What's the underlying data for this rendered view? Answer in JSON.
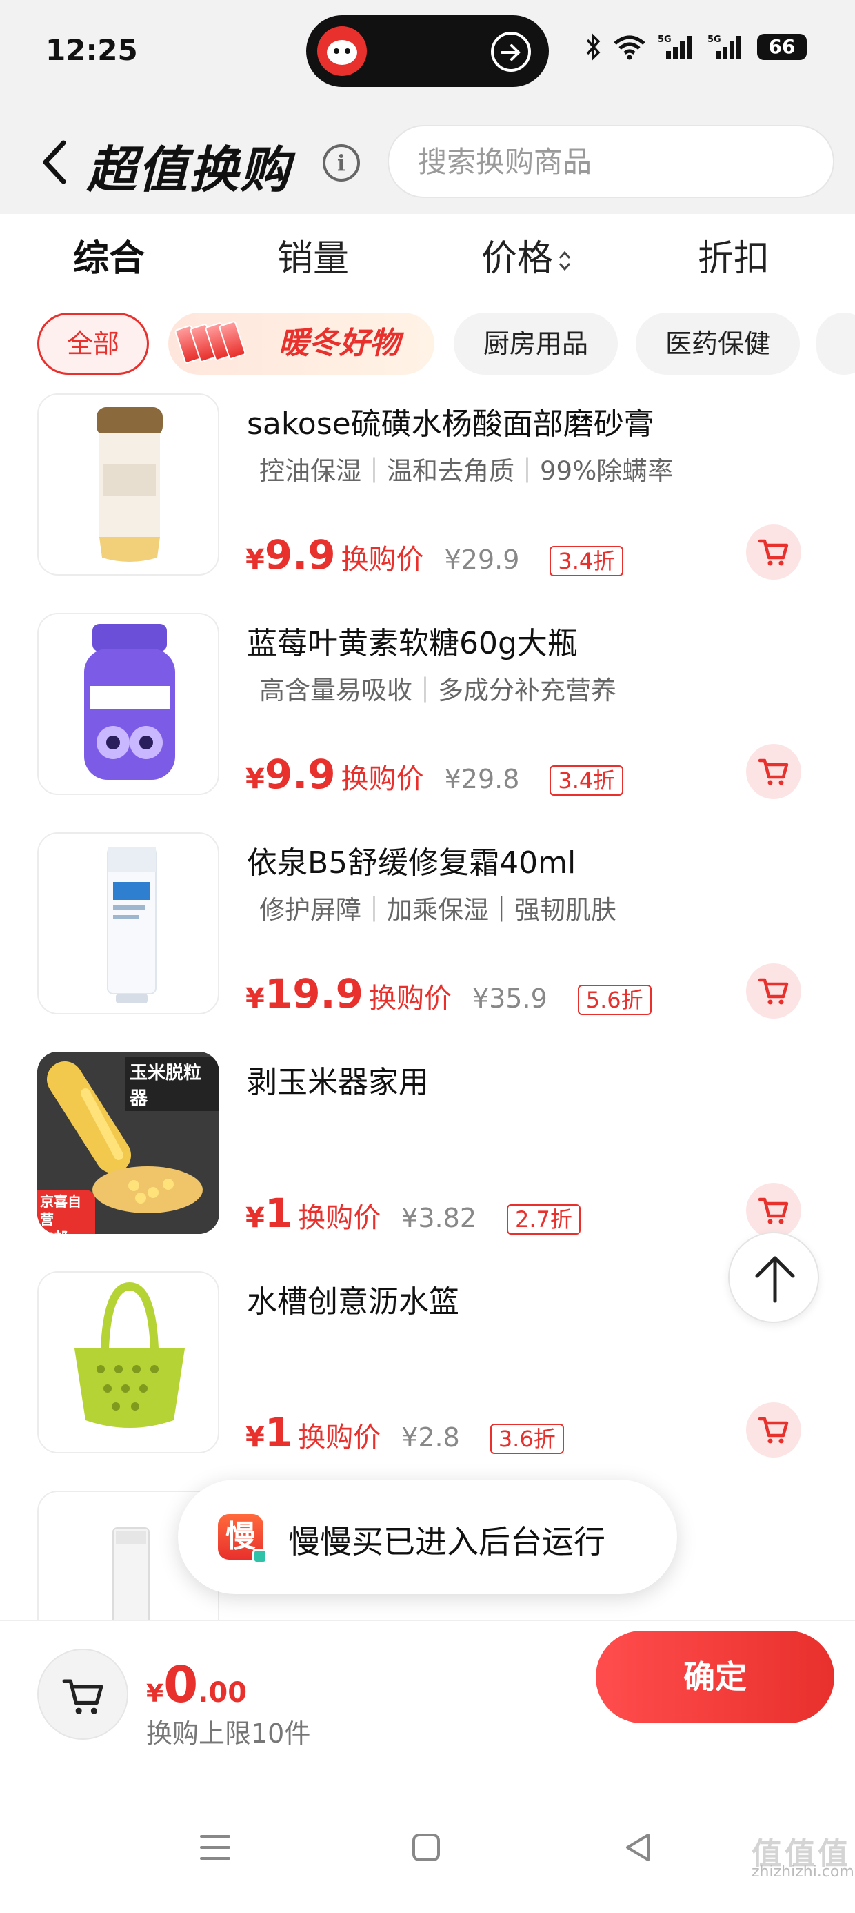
{
  "status_bar": {
    "time": "12:25",
    "battery": "66",
    "network": "5G"
  },
  "header": {
    "back_icon": "chevron-left-icon",
    "title": "超值换购",
    "info_icon": "i",
    "search_placeholder": "搜索换购商品"
  },
  "sort_tabs": [
    {
      "label": "综合",
      "active": true
    },
    {
      "label": "销量",
      "active": false
    },
    {
      "label": "价格",
      "active": false
    },
    {
      "label": "折扣",
      "active": false
    }
  ],
  "chips": [
    {
      "label": "全部",
      "active": true
    },
    {
      "label": "暖冬好物",
      "banner": true
    },
    {
      "label": "厨房用品"
    },
    {
      "label": "医药保健"
    }
  ],
  "price_label": "换购价",
  "items": [
    {
      "name": "sakose硫磺水杨酸面部磨砂膏",
      "tags": "控油保湿｜温和去角质｜99%除螨率",
      "price_symbol": "¥",
      "price": "9.9",
      "original_price": "¥29.9",
      "discount": "3.4折"
    },
    {
      "name": "蓝莓叶黄素软糖60g大瓶",
      "tags": "高含量易吸收｜多成分补充营养",
      "price_symbol": "¥",
      "price": "9.9",
      "original_price": "¥29.8",
      "discount": "3.4折"
    },
    {
      "name": "依泉B5舒缓修复霜40ml",
      "tags": "修护屏障｜加乘保湿｜强韧肌肤",
      "price_symbol": "¥",
      "price": "19.9",
      "original_price": "¥35.9",
      "discount": "5.6折"
    },
    {
      "name": "剥玉米器家用",
      "tags": "",
      "price_symbol": "¥",
      "price": "1",
      "original_price": "¥3.82",
      "discount": "2.7折",
      "thumb_text": "玉米脱粒器",
      "thumb_badge": "京喜自营\n包邮"
    },
    {
      "name": "水槽创意沥水篮",
      "tags": "",
      "price_symbol": "¥",
      "price": "1",
      "original_price": "¥2.8",
      "discount": "3.6折"
    }
  ],
  "toast": {
    "icon_text": "慢",
    "message": "慢慢买已进入后台运行"
  },
  "bottom_bar": {
    "price_symbol": "¥",
    "total_int": "0",
    "total_dec": ".00",
    "limit_text": "换购上限10件",
    "confirm_label": "确定"
  },
  "watermark": {
    "brand": "值值值",
    "url": "zhizhizhi.com"
  },
  "colors": {
    "accent": "#e8302c",
    "background": "#f2f2f2",
    "chip_bg": "#f3f3f3"
  }
}
